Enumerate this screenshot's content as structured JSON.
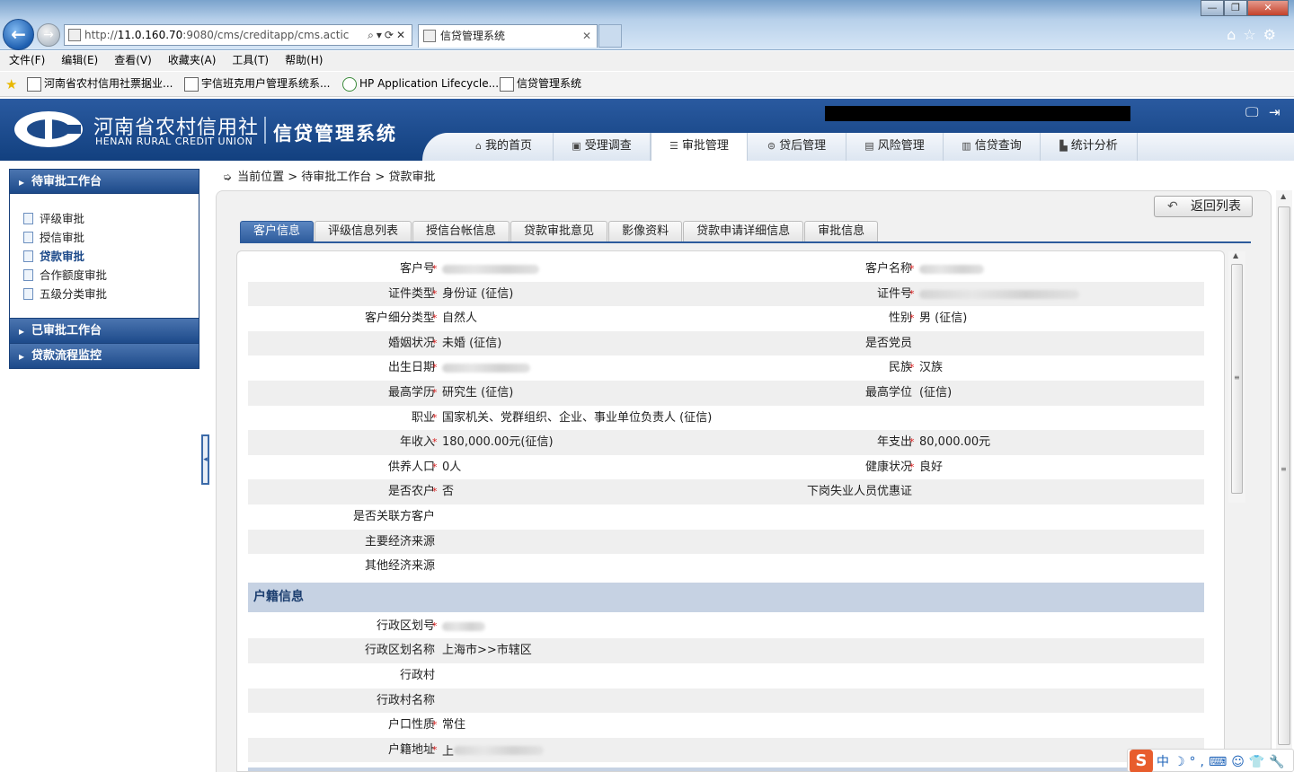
{
  "browser": {
    "url_prefix": "http://",
    "url_host": "11.0.160.70",
    "url_rest": ":9080/cms/creditapp/cms.actic",
    "tab_title": "信贷管理系统",
    "menu": [
      "文件(F)",
      "编辑(E)",
      "查看(V)",
      "收藏夹(A)",
      "工具(T)",
      "帮助(H)"
    ],
    "favorites": [
      "河南省农村信用社票据业...",
      "宇信班克用户管理系统系...",
      "HP Application Lifecycle...",
      "信贷管理系统"
    ]
  },
  "header": {
    "org_cn": "河南省农村信用社",
    "org_en": "HENAN RURAL CREDIT UNION",
    "system_name": "信贷管理系统",
    "nav": [
      "我的首页",
      "受理调查",
      "审批管理",
      "贷后管理",
      "风险管理",
      "信贷查询",
      "统计分析"
    ],
    "nav_active": "审批管理"
  },
  "sidebar": {
    "pending_title": "待审批工作台",
    "pending_items": [
      "评级审批",
      "授信审批",
      "贷款审批",
      "合作额度审批",
      "五级分类审批"
    ],
    "current_item": "贷款审批",
    "approved_title": "已审批工作台",
    "monitor_title": "贷款流程监控"
  },
  "breadcrumb": {
    "label": "当前位置",
    "sep": ">",
    "level1": "待审批工作台",
    "level2": "贷款审批"
  },
  "toolbar": {
    "back_label": "返回列表"
  },
  "tabs": [
    "客户信息",
    "评级信息列表",
    "授信台帐信息",
    "贷款审批意见",
    "影像资料",
    "贷款申请详细信息",
    "审批信息"
  ],
  "tab_active": "客户信息",
  "customer": {
    "customer_no_label": "客户号",
    "customer_name_label": "客户名称",
    "id_type_label": "证件类型",
    "id_type": "身份证 (征信)",
    "id_no_label": "证件号",
    "subtype_label": "客户细分类型",
    "subtype": "自然人",
    "gender_label": "性别",
    "gender": "男 (征信)",
    "marital_label": "婚姻状况",
    "marital": "未婚 (征信)",
    "party_label": "是否党员",
    "birth_label": "出生日期",
    "ethnic_label": "民族",
    "ethnic": "汉族",
    "edu_label": "最高学历",
    "edu": "研究生 (征信)",
    "degree_label": "最高学位",
    "degree": " (征信)",
    "job_label": "职业",
    "job": "国家机关、党群组织、企业、事业单位负责人 (征信)",
    "income_label": "年收入",
    "income": "180,000.00元(征信)",
    "expense_label": "年支出",
    "expense": "80,000.00元",
    "dependents_label": "供养人口",
    "dependents": "0人",
    "health_label": "健康状况",
    "health": "良好",
    "farmer_label": "是否农户",
    "farmer": "否",
    "laidoff_label": "下岗失业人员优惠证",
    "related_label": "是否关联方客户",
    "main_income_label": "主要经济来源",
    "other_income_label": "其他经济来源"
  },
  "household": {
    "section_title": "户籍信息",
    "region_code_label": "行政区划号",
    "region_name_label": "行政区划名称",
    "region_name": "上海市>>市辖区",
    "village_label": "行政村",
    "village_name_label": "行政村名称",
    "hukou_type_label": "户口性质",
    "hukou_type": "常住",
    "hukou_addr_label": "户籍地址",
    "hukou_addr_prefix": "上"
  },
  "ime": {
    "logo": "S",
    "mode": "中"
  },
  "colors": {
    "header_blue": "#1d4a8a",
    "tab_active": "#2d5b9c",
    "section": "#c6d2e3",
    "required": "#d81e1e"
  }
}
